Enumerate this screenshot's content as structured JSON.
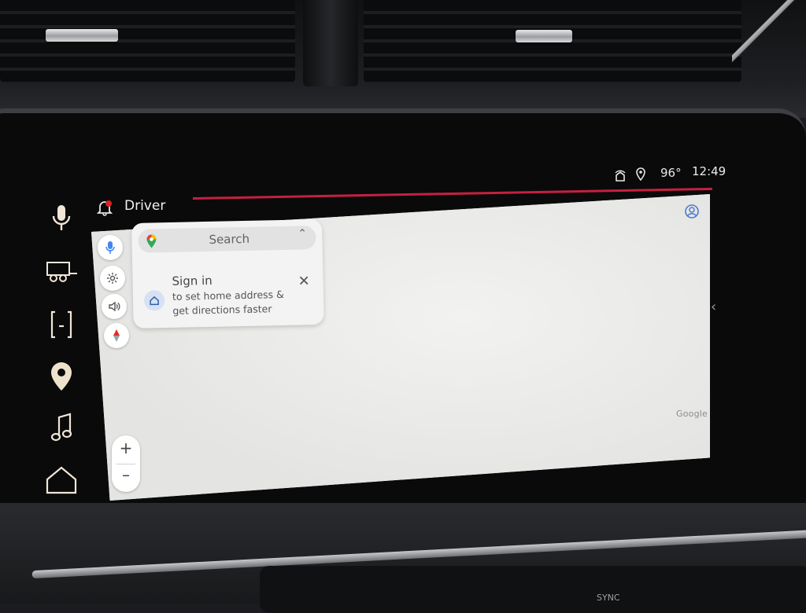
{
  "status_bar": {
    "temperature": "96°",
    "time": "12:49"
  },
  "profile": {
    "label": "Driver"
  },
  "search": {
    "placeholder": "Search"
  },
  "signin_card": {
    "title": "Sign in",
    "body": "to set home address & get directions faster"
  },
  "map": {
    "attribution": "Google"
  },
  "zoom": {
    "in_label": "+",
    "out_label": "–"
  },
  "dash": {
    "button_label": "SYNC"
  },
  "colors": {
    "accent": "#c62040",
    "rail_icons": "#f1e6d6",
    "active_rail_icon": "#efe2cc"
  },
  "icons": {
    "rail": [
      "microphone-icon",
      "trailer-icon",
      "phone-projection-icon",
      "navigation-pin-icon",
      "music-note-icon",
      "home-icon"
    ]
  }
}
